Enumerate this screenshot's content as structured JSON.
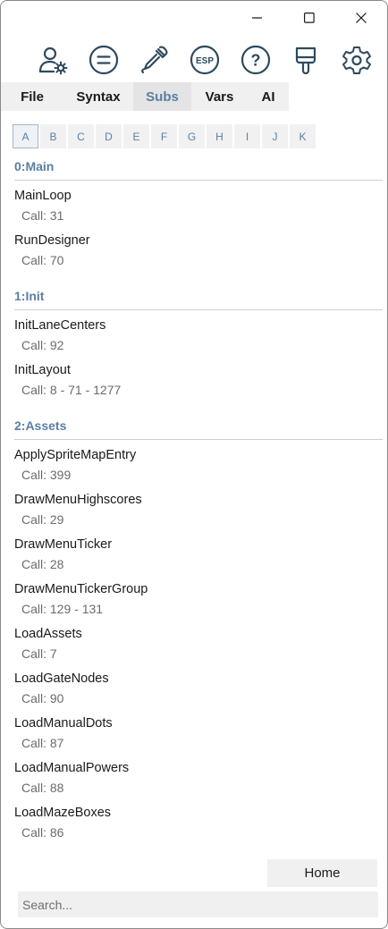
{
  "window_controls": {
    "minimize": "minimize-icon",
    "maximize": "maximize-icon",
    "close": "close-icon"
  },
  "toolbar": {
    "icons": [
      "user-settings-icon",
      "equals-icon",
      "eyedropper-icon",
      "esp-icon",
      "help-icon",
      "paint-brush-icon",
      "gear-icon"
    ],
    "esp_text": "ESP",
    "help_text": "?"
  },
  "tabs": [
    {
      "label": "File"
    },
    {
      "label": "Syntax"
    },
    {
      "label": "Subs",
      "active": true
    },
    {
      "label": "Vars"
    },
    {
      "label": "AI"
    }
  ],
  "letters": [
    "A",
    "B",
    "C",
    "D",
    "E",
    "F",
    "G",
    "H",
    "I",
    "J",
    "K"
  ],
  "active_letter": "A",
  "groups": [
    {
      "title": "0:Main",
      "subs": [
        {
          "name": "MainLoop",
          "call": "Call: 31"
        },
        {
          "name": "RunDesigner",
          "call": "Call: 70"
        }
      ]
    },
    {
      "title": "1:Init",
      "subs": [
        {
          "name": "InitLaneCenters",
          "call": "Call: 92"
        },
        {
          "name": "InitLayout",
          "call": "Call: 8 - 71 - 1277"
        }
      ]
    },
    {
      "title": "2:Assets",
      "subs": [
        {
          "name": "ApplySpriteMapEntry",
          "call": "Call: 399"
        },
        {
          "name": "DrawMenuHighscores",
          "call": "Call: 29"
        },
        {
          "name": "DrawMenuTicker",
          "call": "Call: 28"
        },
        {
          "name": "DrawMenuTickerGroup",
          "call": "Call: 129 - 131"
        },
        {
          "name": "LoadAssets",
          "call": "Call: 7"
        },
        {
          "name": "LoadGateNodes",
          "call": "Call: 90"
        },
        {
          "name": "LoadManualDots",
          "call": "Call: 87"
        },
        {
          "name": "LoadManualPowers",
          "call": "Call: 88"
        },
        {
          "name": "LoadMazeBoxes",
          "call": "Call: 86"
        }
      ]
    }
  ],
  "home_button": "Home",
  "search": {
    "placeholder": "Search...",
    "value": ""
  },
  "colors": {
    "accent": "#5a7ea3",
    "icon": "#2e4a5e",
    "tab_bg": "#f0f0f0"
  }
}
